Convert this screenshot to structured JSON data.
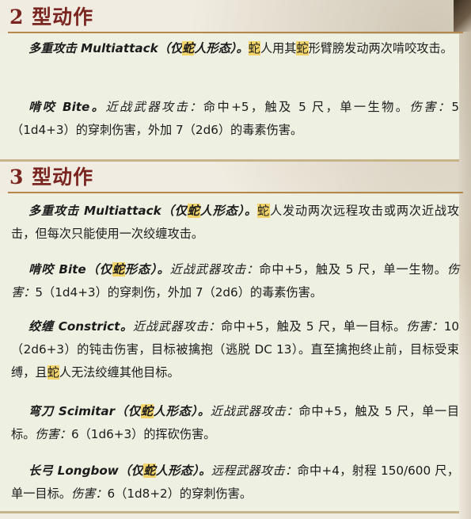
{
  "highlight_color": "#f3d46b",
  "heading_color": "#7a2520",
  "sections": [
    {
      "title": "2 型动作",
      "paragraphs": [
        [
          {
            "t": "多重攻击 Multiattack（仅",
            "s": "b"
          },
          {
            "t": "蛇",
            "s": "b hl"
          },
          {
            "t": "人形态）。",
            "s": "b"
          },
          {
            "t": "蛇",
            "s": "hl"
          },
          {
            "t": "人用其",
            "s": ""
          },
          {
            "t": "蛇",
            "s": "hl"
          },
          {
            "t": "形臂膀发动两次啃咬攻击。",
            "s": ""
          }
        ],
        [
          {
            "t": "啃咬 Bite。",
            "s": "b"
          },
          {
            "t": "近战武器攻击：",
            "s": "i"
          },
          {
            "t": "命中+5，触及 5 尺，单一生物。",
            "s": ""
          },
          {
            "t": "伤害：",
            "s": "i"
          },
          {
            "t": "5（1d4+3）的穿刺伤害，外加 7（2d6）的毒素伤害。",
            "s": ""
          }
        ]
      ]
    },
    {
      "title": "3 型动作",
      "paragraphs": [
        [
          {
            "t": "多重攻击 Multiattack（仅",
            "s": "b"
          },
          {
            "t": "蛇",
            "s": "b hl"
          },
          {
            "t": "人形态）。",
            "s": "b"
          },
          {
            "t": "蛇",
            "s": "hl"
          },
          {
            "t": "人发动两次远程攻击或两次近战攻击，但每次只能使用一次绞缠攻击。",
            "s": ""
          }
        ],
        [
          {
            "t": "啃咬 Bite（仅",
            "s": "b"
          },
          {
            "t": "蛇",
            "s": "b hl"
          },
          {
            "t": "形态）。",
            "s": "b"
          },
          {
            "t": "近战武器攻击：",
            "s": "i"
          },
          {
            "t": "命中+5，触及 5 尺，单一生物。",
            "s": ""
          },
          {
            "t": "伤害：",
            "s": "i"
          },
          {
            "t": "5（1d4+3）的穿刺伤，外加 7（2d6）的毒素伤害。",
            "s": ""
          }
        ],
        [
          {
            "t": "绞缠 Constrict。",
            "s": "b"
          },
          {
            "t": "近战武器攻击：",
            "s": "i"
          },
          {
            "t": "命中+5，触及 5 尺，单一目标。",
            "s": ""
          },
          {
            "t": "伤害：",
            "s": "i"
          },
          {
            "t": "10（2d6+3）的钝击伤害，目标被擒抱（逃脱 DC 13）。直至擒抱终止前，目标受束缚，且",
            "s": ""
          },
          {
            "t": "蛇",
            "s": "hl"
          },
          {
            "t": "人无法绞缠其他目标。",
            "s": ""
          }
        ],
        [
          {
            "t": "弯刀 Scimitar（仅",
            "s": "b"
          },
          {
            "t": "蛇",
            "s": "b hl"
          },
          {
            "t": "人形态）。",
            "s": "b"
          },
          {
            "t": "近战武器攻击：",
            "s": "i"
          },
          {
            "t": "命中+5，触及 5 尺，单一目标。",
            "s": ""
          },
          {
            "t": "伤害：",
            "s": "i"
          },
          {
            "t": "6（1d6+3）的挥砍伤害。",
            "s": ""
          }
        ],
        [
          {
            "t": "长弓 Longbow（仅",
            "s": "b"
          },
          {
            "t": "蛇",
            "s": "b hl"
          },
          {
            "t": "人形态）。",
            "s": "b"
          },
          {
            "t": "远程武器攻击：",
            "s": "i"
          },
          {
            "t": "命中+4，射程 150/600 尺，单一目标。",
            "s": ""
          },
          {
            "t": "伤害：",
            "s": "i"
          },
          {
            "t": "6（1d8+2）的穿刺伤害。",
            "s": ""
          }
        ]
      ]
    }
  ]
}
